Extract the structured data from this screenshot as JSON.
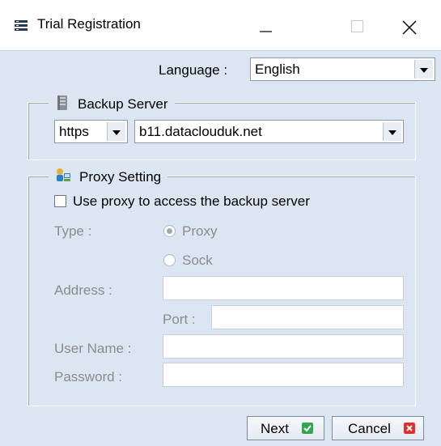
{
  "window": {
    "title": "Trial Registration"
  },
  "language": {
    "label": "Language :",
    "value": "English"
  },
  "backup_server": {
    "legend": "Backup Server",
    "protocol": "https",
    "host": "b11.dataclouduk.net"
  },
  "proxy": {
    "legend": "Proxy Setting",
    "use_proxy_label": "Use proxy to access the backup server",
    "use_proxy_checked": false,
    "type_label": "Type :",
    "type_options": [
      "Proxy",
      "Sock"
    ],
    "type_selected": "Proxy",
    "address_label": "Address :",
    "address_value": "",
    "port_label": "Port :",
    "port_value": "",
    "username_label": "User Name :",
    "username_value": "",
    "password_label": "Password :",
    "password_value": ""
  },
  "buttons": {
    "next": "Next",
    "cancel": "Cancel"
  },
  "icons": {
    "app": "server-rack-icon",
    "backup_server": "server-icon",
    "proxy": "network-user-icon",
    "next": "check-icon",
    "cancel": "close-red-icon"
  },
  "colors": {
    "client_bg": "#dbe6f2",
    "next_icon": "#2fa84f",
    "cancel_icon": "#e0302b",
    "disabled_text": "#8c8c8c"
  }
}
